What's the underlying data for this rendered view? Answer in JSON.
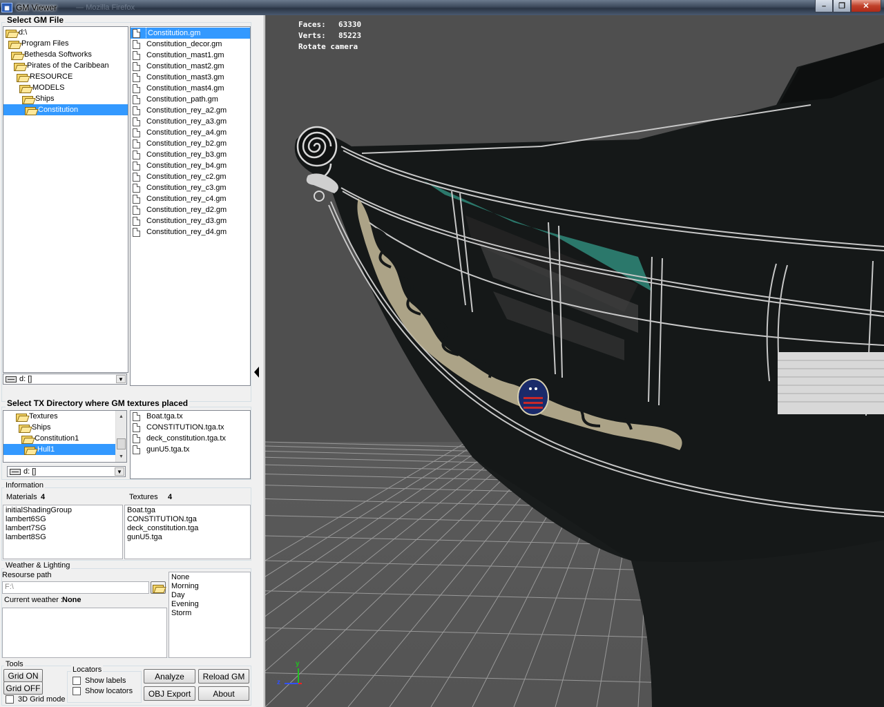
{
  "window": {
    "title": "GM Viewer",
    "ghost_title": "— Mozilla Firefox"
  },
  "gm_file": {
    "group_title": "Select GM File",
    "tree": [
      {
        "label": "d:\\",
        "depth": 0
      },
      {
        "label": "Program Files",
        "depth": 1
      },
      {
        "label": "Bethesda Softworks",
        "depth": 2
      },
      {
        "label": "Pirates of the Caribbean",
        "depth": 3
      },
      {
        "label": "RESOURCE",
        "depth": 4
      },
      {
        "label": "MODELS",
        "depth": 5
      },
      {
        "label": "Ships",
        "depth": 6
      },
      {
        "label": "Constitution",
        "depth": 7,
        "selected": true
      }
    ],
    "drive": "d: []",
    "files": [
      "Constitution.gm",
      "Constitution_decor.gm",
      "Constitution_mast1.gm",
      "Constitution_mast2.gm",
      "Constitution_mast3.gm",
      "Constitution_mast4.gm",
      "Constitution_path.gm",
      "Constitution_rey_a2.gm",
      "Constitution_rey_a3.gm",
      "Constitution_rey_a4.gm",
      "Constitution_rey_b2.gm",
      "Constitution_rey_b3.gm",
      "Constitution_rey_b4.gm",
      "Constitution_rey_c2.gm",
      "Constitution_rey_c3.gm",
      "Constitution_rey_c4.gm",
      "Constitution_rey_d2.gm",
      "Constitution_rey_d3.gm",
      "Constitution_rey_d4.gm"
    ],
    "selected_file": "Constitution.gm"
  },
  "tx_dir": {
    "group_title": "Select TX Directory where GM textures placed",
    "tree": [
      {
        "label": "Textures",
        "depth": 1
      },
      {
        "label": "Ships",
        "depth": 2
      },
      {
        "label": "Constitution1",
        "depth": 3
      },
      {
        "label": "Hull1",
        "depth": 4,
        "selected": true
      }
    ],
    "drive": "d: []",
    "files": [
      "Boat.tga.tx",
      "CONSTITUTION.tga.tx",
      "deck_constitution.tga.tx",
      "gunU5.tga.tx"
    ]
  },
  "information": {
    "group_title": "Information",
    "materials_label": "Materials",
    "materials_count": "4",
    "textures_label": "Textures",
    "textures_count": "4",
    "materials": [
      "initialShadingGroup",
      "lambert6SG",
      "lambert7SG",
      "lambert8SG"
    ],
    "textures": [
      "Boat.tga",
      "CONSTITUTION.tga",
      "deck_constitution.tga",
      "gunU5.tga"
    ]
  },
  "weather": {
    "group_title": "Weather & Lighting",
    "resource_path_label": "Resourse path",
    "resource_path_value": "F:\\",
    "current_weather_label": "Current weather :",
    "current_weather_value": "None",
    "options": [
      "None",
      "Morning",
      "Day",
      "Evening",
      "Storm"
    ]
  },
  "tools": {
    "group_title": "Tools",
    "grid_on": "Grid ON",
    "grid_off": "Grid OFF",
    "grid_3d": "3D Grid mode",
    "locators_title": "Locators",
    "show_labels": "Show labels",
    "show_locators": "Show locators",
    "analyze": "Analyze",
    "reload": "Reload GM",
    "obj_export": "OBJ Export",
    "about": "About"
  },
  "viewport": {
    "faces_label": "Faces:",
    "faces_value": "63330",
    "verts_label": "Verts:",
    "verts_value": "85223",
    "mode": "Rotate camera",
    "axis_y": "y",
    "axis_z": "z"
  },
  "colors": {
    "selection": "#3399ff",
    "viewport_bg": "#4f4f4f",
    "hull": "#151818",
    "grid": "#a8a8a8",
    "ornament": "#bdb394",
    "teal": "#3d9a8a"
  },
  "icons": [
    "app-icon",
    "folder-icon",
    "file-icon",
    "drive-icon",
    "browse-folder-icon",
    "minimize-icon",
    "maximize-icon",
    "close-icon"
  ]
}
